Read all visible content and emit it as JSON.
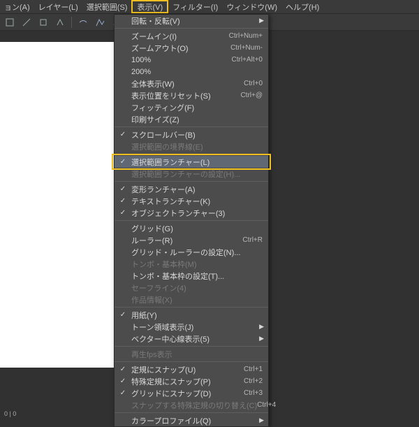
{
  "menubar": {
    "items": [
      "ョン(A)",
      "レイヤー(L)",
      "選択範囲(S)",
      "表示(V)",
      "フィルター(I)",
      "ウィンドウ(W)",
      "ヘルプ(H)"
    ],
    "primary_index": 3
  },
  "status": "0 | 0",
  "dropdown": [
    {
      "type": "item",
      "label": "回転・反転(V)",
      "submenu": true
    },
    {
      "type": "sep"
    },
    {
      "type": "item",
      "label": "ズームイン(I)",
      "accel": "Ctrl+Num+"
    },
    {
      "type": "item",
      "label": "ズームアウト(O)",
      "accel": "Ctrl+Num-"
    },
    {
      "type": "item",
      "label": "100%",
      "accel": "Ctrl+Alt+0"
    },
    {
      "type": "item",
      "label": "200%"
    },
    {
      "type": "item",
      "label": "全体表示(W)",
      "accel": "Ctrl+0"
    },
    {
      "type": "item",
      "label": "表示位置をリセット(S)",
      "accel": "Ctrl+@"
    },
    {
      "type": "item",
      "label": "フィッティング(F)"
    },
    {
      "type": "item",
      "label": "印刷サイズ(Z)"
    },
    {
      "type": "sep"
    },
    {
      "type": "item",
      "label": "スクロールバー(B)",
      "checked": true
    },
    {
      "type": "item",
      "label": "選択範囲の境界線(E)",
      "disabled": true
    },
    {
      "type": "sep"
    },
    {
      "type": "item",
      "label": "選択範囲ランチャー(L)",
      "checked": true,
      "highlight": true,
      "boxed": true
    },
    {
      "type": "item",
      "label": "選択範囲ランチャーの設定(H)...",
      "disabled": true
    },
    {
      "type": "sep"
    },
    {
      "type": "item",
      "label": "変形ランチャー(A)",
      "checked": true
    },
    {
      "type": "item",
      "label": "テキストランチャー(K)",
      "checked": true
    },
    {
      "type": "item",
      "label": "オブジェクトランチャー(3)",
      "checked": true
    },
    {
      "type": "sep"
    },
    {
      "type": "item",
      "label": "グリッド(G)"
    },
    {
      "type": "item",
      "label": "ルーラー(R)",
      "accel": "Ctrl+R"
    },
    {
      "type": "item",
      "label": "グリッド・ルーラーの設定(N)..."
    },
    {
      "type": "item",
      "label": "トンボ・基本枠(M)",
      "disabled": true
    },
    {
      "type": "item",
      "label": "トンボ・基本枠の設定(T)..."
    },
    {
      "type": "item",
      "label": "セーフライン(4)",
      "disabled": true
    },
    {
      "type": "item",
      "label": "作品情報(X)",
      "disabled": true
    },
    {
      "type": "sep"
    },
    {
      "type": "item",
      "label": "用紙(Y)",
      "checked": true
    },
    {
      "type": "item",
      "label": "トーン領域表示(J)",
      "submenu": true
    },
    {
      "type": "item",
      "label": "ベクター中心線表示(5)",
      "submenu": true
    },
    {
      "type": "sep"
    },
    {
      "type": "item",
      "label": "再生fps表示",
      "disabled": true
    },
    {
      "type": "sep"
    },
    {
      "type": "item",
      "label": "定規にスナップ(U)",
      "checked": true,
      "accel": "Ctrl+1"
    },
    {
      "type": "item",
      "label": "特殊定規にスナップ(P)",
      "checked": true,
      "accel": "Ctrl+2"
    },
    {
      "type": "item",
      "label": "グリッドにスナップ(D)",
      "checked": true,
      "accel": "Ctrl+3"
    },
    {
      "type": "item",
      "label": "スナップする特殊定規の切り替え(C)",
      "disabled": true,
      "accel": "Ctrl+4"
    },
    {
      "type": "sep"
    },
    {
      "type": "item",
      "label": "カラープロファイル(Q)",
      "submenu": true
    }
  ]
}
